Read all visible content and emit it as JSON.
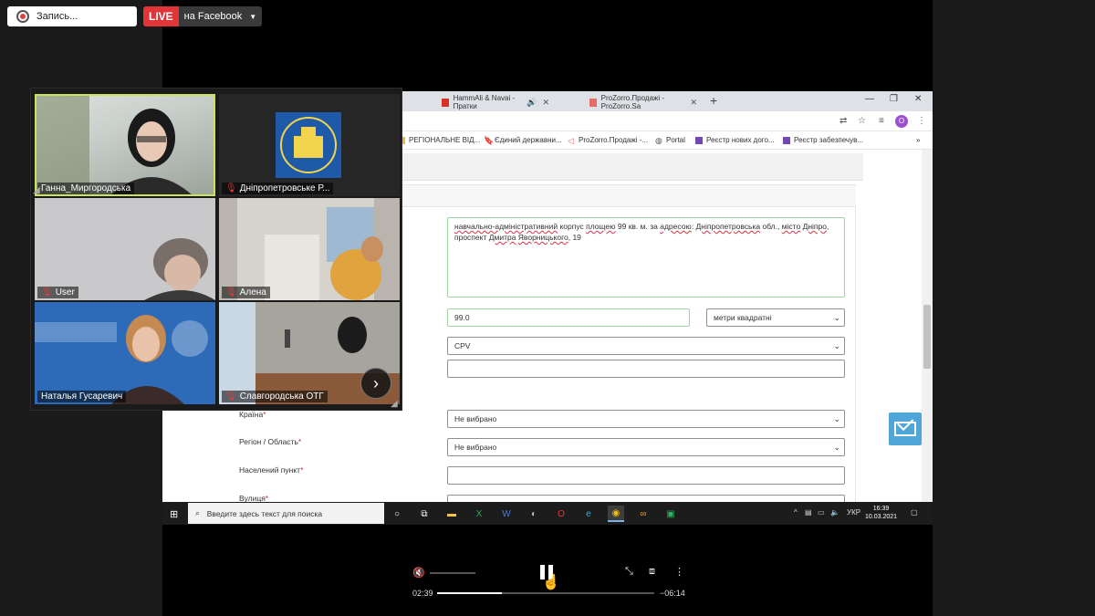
{
  "recording": {
    "label": "Запись..."
  },
  "live": {
    "badge": "LIVE",
    "platform": "на Facebook"
  },
  "browser": {
    "tabs": [
      {
        "title": "HammAli & Navai - Пратки",
        "icon_color": "#d93025"
      },
      {
        "title": "ProZorro.Продажі - ProZorro.Sa",
        "icon_color": "#e86b6b"
      }
    ],
    "profile_initial": "O",
    "bookmarks": [
      {
        "label": "РЕГІОНАЛЬНЕ ВІД...",
        "icon": "folder-icon"
      },
      {
        "label": "Єдиний державни...",
        "icon": "page-icon"
      },
      {
        "label": "ProZorro.Продажі -...",
        "icon": "prozorro-icon"
      },
      {
        "label": "Portal",
        "icon": "globe-icon"
      },
      {
        "label": "Реєстр нових дого...",
        "icon": "form-icon"
      },
      {
        "label": "Реєстр забезпечув...",
        "icon": "form-icon"
      }
    ]
  },
  "form": {
    "description_segments": [
      {
        "text": "навчально-адміністративний",
        "underline": true
      },
      {
        "text": " корпус ",
        "underline": false
      },
      {
        "text": "площею",
        "underline": true
      },
      {
        "text": " 99 кв. м. за ",
        "underline": false
      },
      {
        "text": "адресою",
        "underline": true
      },
      {
        "text": ": ",
        "underline": false
      },
      {
        "text": "Дніпропетровська",
        "underline": true
      },
      {
        "text": " обл., ",
        "underline": false
      },
      {
        "text": "місто",
        "underline": true
      },
      {
        "text": " ",
        "underline": false
      },
      {
        "text": "Дніпро",
        "underline": true
      },
      {
        "text": ", проспект ",
        "underline": false
      },
      {
        "text": "Дмитра",
        "underline": true
      },
      {
        "text": " ",
        "underline": false
      },
      {
        "text": "Яворницького",
        "underline": true
      },
      {
        "text": ", 19",
        "underline": false
      }
    ],
    "area_value": "99.0",
    "unit_select": "метри квадратні",
    "classifier_select": "CPV",
    "fields": [
      {
        "label": "Країна",
        "value": "Не вибрано",
        "type": "select"
      },
      {
        "label": "Регіон / Область",
        "value": "Не вибрано",
        "type": "select"
      },
      {
        "label": "Населений пункт",
        "value": "",
        "type": "input"
      },
      {
        "label": "Вулиця",
        "value": "",
        "type": "input"
      }
    ]
  },
  "taskbar": {
    "search_placeholder": "Введите здесь текст для поиска",
    "lang": "УКР",
    "time": "16:39",
    "date": "10.03.2021"
  },
  "participants": [
    {
      "name": "Ганна_Миргородська",
      "muted": false,
      "speaking": true
    },
    {
      "name": "Дніпропетровське Р...",
      "muted": true,
      "speaking": false
    },
    {
      "name": "User",
      "muted": true,
      "speaking": false
    },
    {
      "name": "Алена",
      "muted": true,
      "speaking": false
    },
    {
      "name": "Наталья Гусаревич",
      "muted": false,
      "speaking": false
    },
    {
      "name": "Славгородська ОТГ",
      "muted": true,
      "speaking": false
    }
  ],
  "player": {
    "elapsed": "02:39",
    "remaining": "−06:14",
    "progress": 0.3
  },
  "colors": {
    "live_red": "#e3343a",
    "speaking_outline": "#c9e35c",
    "valid_field_border": "#9fd4a2",
    "required_star": "#d0302f"
  }
}
